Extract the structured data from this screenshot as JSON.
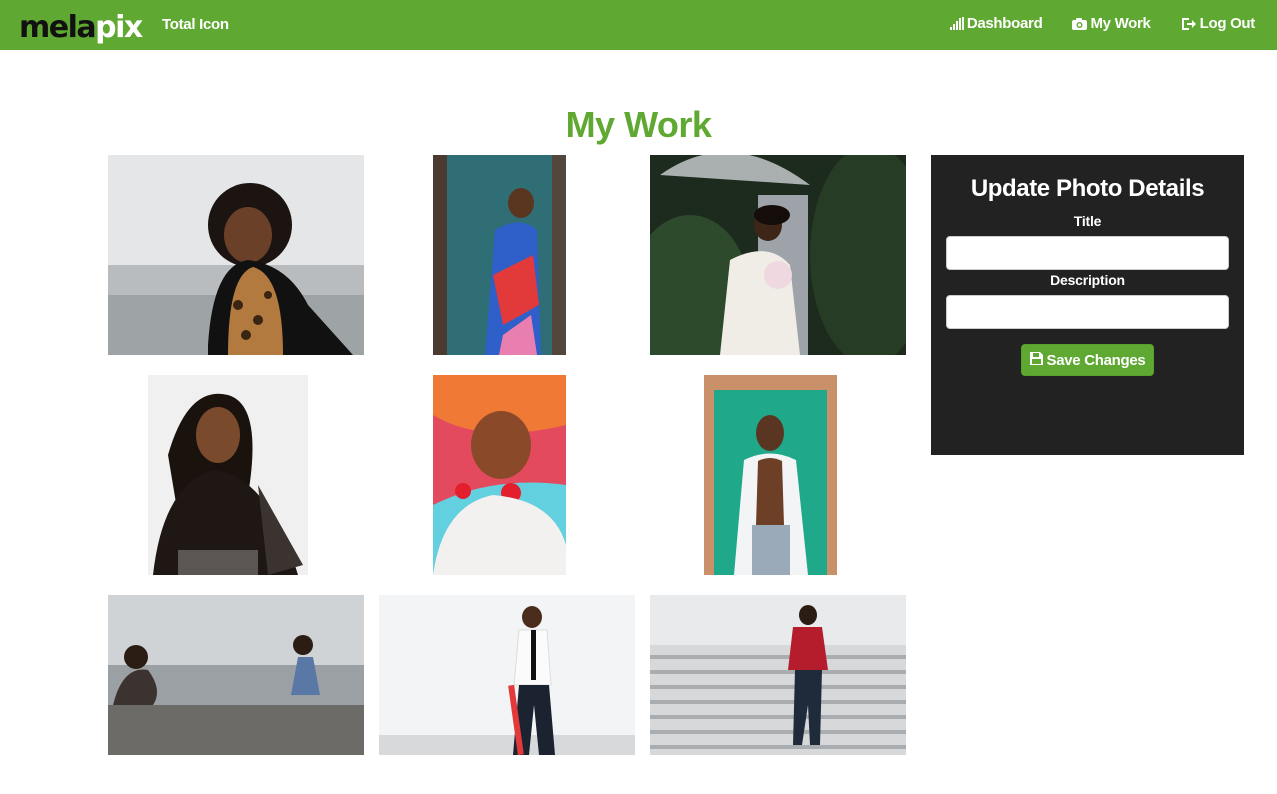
{
  "navbar": {
    "logo_part1": "mela",
    "logo_part2": "pix",
    "brand_subtitle": "Total Icon",
    "links": [
      {
        "label": "Dashboard",
        "icon": "signal-bars-icon"
      },
      {
        "label": "My Work",
        "icon": "camera-icon"
      },
      {
        "label": "Log Out",
        "icon": "logout-icon"
      }
    ],
    "background_color": "#5fa832"
  },
  "main": {
    "title": "My Work",
    "title_color": "#5fa832",
    "photos": [
      {
        "subject": "girl in leopard fur vest"
      },
      {
        "subject": "woman in colorful dress by teal door"
      },
      {
        "subject": "bride and groom under clear umbrella"
      },
      {
        "subject": "woman in black with long hair"
      },
      {
        "subject": "woman with colorful backdrop and earrings"
      },
      {
        "subject": "man with open white shirt by green door"
      },
      {
        "subject": "man and little girl on sidewalk"
      },
      {
        "subject": "man in white shirt and tie with cane"
      },
      {
        "subject": "man in red jacket on steps"
      }
    ]
  },
  "panel": {
    "title": "Update Photo Details",
    "title_label": "Title",
    "title_value": "",
    "description_label": "Description",
    "description_value": "",
    "save_label": "Save Changes",
    "save_icon": "floppy-disk-icon",
    "background_color": "#222222"
  }
}
